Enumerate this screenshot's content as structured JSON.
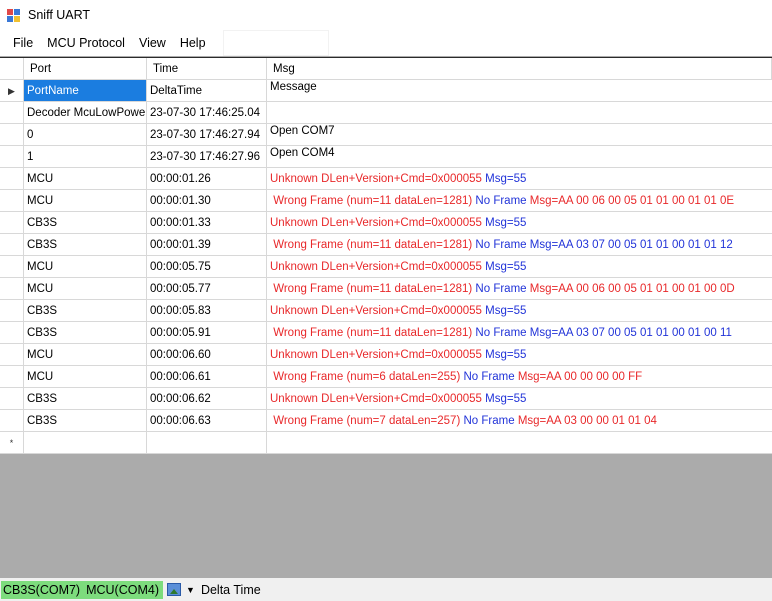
{
  "window": {
    "title": "Sniff UART"
  },
  "menu": {
    "items": [
      "File",
      "MCU Protocol",
      "View",
      "Help"
    ],
    "search_value": ""
  },
  "grid": {
    "columns": [
      "Port",
      "Time",
      "Msg"
    ],
    "new_row_marker": "*",
    "rows": [
      {
        "port": "PortName",
        "time": "DeltaTime",
        "msg": [
          {
            "text": "Message",
            "color": "black"
          }
        ],
        "current": true
      },
      {
        "port": "Decoder McuLowPower",
        "time": "23-07-30 17:46:25.04",
        "msg": []
      },
      {
        "port": "0",
        "time": "23-07-30 17:46:27.94",
        "msg": [
          {
            "text": "Open COM7",
            "color": "black"
          }
        ]
      },
      {
        "port": "1",
        "time": "23-07-30 17:46:27.96",
        "msg": [
          {
            "text": "Open COM4",
            "color": "black"
          }
        ]
      },
      {
        "port": "MCU",
        "time": "00:00:01.26",
        "msg": [
          {
            "text": "Unknown DLen+Version+Cmd=0x000055 ",
            "color": "red"
          },
          {
            "text": "Msg=55",
            "color": "blue"
          }
        ]
      },
      {
        "port": "MCU",
        "time": "00:00:01.30",
        "msg": [
          {
            "text": " Wrong Frame (num=11 dataLen=1281) ",
            "color": "red"
          },
          {
            "text": "No Frame ",
            "color": "blue"
          },
          {
            "text": "Msg=AA 00 06 00 05 01 01 00 01 01 0E",
            "color": "red"
          }
        ]
      },
      {
        "port": "CB3S",
        "time": "00:00:01.33",
        "msg": [
          {
            "text": "Unknown DLen+Version+Cmd=0x000055 ",
            "color": "red"
          },
          {
            "text": "Msg=55",
            "color": "blue"
          }
        ]
      },
      {
        "port": "CB3S",
        "time": "00:00:01.39",
        "msg": [
          {
            "text": " Wrong Frame (num=11 dataLen=1281) ",
            "color": "red"
          },
          {
            "text": "No Frame Msg=AA 03 07 00 05 01 01 00 01 01 12",
            "color": "blue"
          }
        ]
      },
      {
        "port": "MCU",
        "time": "00:00:05.75",
        "msg": [
          {
            "text": "Unknown DLen+Version+Cmd=0x000055 ",
            "color": "red"
          },
          {
            "text": "Msg=55",
            "color": "blue"
          }
        ]
      },
      {
        "port": "MCU",
        "time": "00:00:05.77",
        "msg": [
          {
            "text": " Wrong Frame (num=11 dataLen=1281) ",
            "color": "red"
          },
          {
            "text": "No Frame ",
            "color": "blue"
          },
          {
            "text": "Msg=AA 00 06 00 05 01 01 00 01 00 0D",
            "color": "red"
          }
        ]
      },
      {
        "port": "CB3S",
        "time": "00:00:05.83",
        "msg": [
          {
            "text": "Unknown DLen+Version+Cmd=0x000055 ",
            "color": "red"
          },
          {
            "text": "Msg=55",
            "color": "blue"
          }
        ]
      },
      {
        "port": "CB3S",
        "time": "00:00:05.91",
        "msg": [
          {
            "text": " Wrong Frame (num=11 dataLen=1281) ",
            "color": "red"
          },
          {
            "text": "No Frame Msg=AA 03 07 00 05 01 01 00 01 00 11",
            "color": "blue"
          }
        ]
      },
      {
        "port": "MCU",
        "time": "00:00:06.60",
        "msg": [
          {
            "text": "Unknown DLen+Version+Cmd=0x000055 ",
            "color": "red"
          },
          {
            "text": "Msg=55",
            "color": "blue"
          }
        ]
      },
      {
        "port": "MCU",
        "time": "00:00:06.61",
        "msg": [
          {
            "text": " Wrong Frame (num=6 dataLen=255) ",
            "color": "red"
          },
          {
            "text": "No Frame ",
            "color": "blue"
          },
          {
            "text": "Msg=AA 00 00 00 00 FF",
            "color": "red"
          }
        ]
      },
      {
        "port": "CB3S",
        "time": "00:00:06.62",
        "msg": [
          {
            "text": "Unknown DLen+Version+Cmd=0x000055 ",
            "color": "red"
          },
          {
            "text": "Msg=55",
            "color": "blue"
          }
        ]
      },
      {
        "port": "CB3S",
        "time": "00:00:06.63",
        "msg": [
          {
            "text": " Wrong Frame (num=7 dataLen=257) ",
            "color": "red"
          },
          {
            "text": "No Frame ",
            "color": "blue"
          },
          {
            "text": "Msg=AA 03 00 00 01 01 04",
            "color": "red"
          }
        ]
      }
    ]
  },
  "status": {
    "com_ports": [
      "CB3S(COM7)",
      "MCU(COM4)"
    ],
    "dropdown_label": "Delta Time",
    "icon": "image-icon",
    "com_color": "#7ddc7d"
  }
}
